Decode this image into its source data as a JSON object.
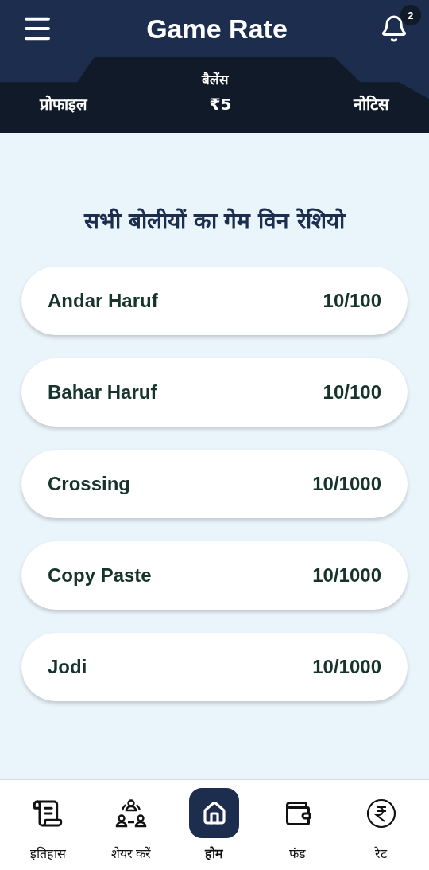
{
  "header": {
    "title": "Game Rate",
    "notification_count": "2"
  },
  "balance_panel": {
    "left": "प्रोफाइल",
    "balance_label": "बैलेंस",
    "balance": "₹5",
    "right": "नोटिस"
  },
  "heading": "सभी बोलीयों का गेम विन रेशियो",
  "rates": [
    {
      "name": "Andar Haruf",
      "rate": "10/100"
    },
    {
      "name": "Bahar Haruf",
      "rate": "10/100"
    },
    {
      "name": "Crossing",
      "rate": "10/1000"
    },
    {
      "name": "Copy Paste",
      "rate": "10/1000"
    },
    {
      "name": "Jodi",
      "rate": "10/1000"
    }
  ],
  "bottom_nav": [
    {
      "kind": "history",
      "label": "इतिहास",
      "selected": false
    },
    {
      "kind": "share",
      "label": "शेयर करें",
      "selected": false
    },
    {
      "kind": "home",
      "label": "होम",
      "selected": true
    },
    {
      "kind": "fund",
      "label": "फंड",
      "selected": false
    },
    {
      "kind": "rate",
      "label": "रेट",
      "selected": false
    }
  ]
}
